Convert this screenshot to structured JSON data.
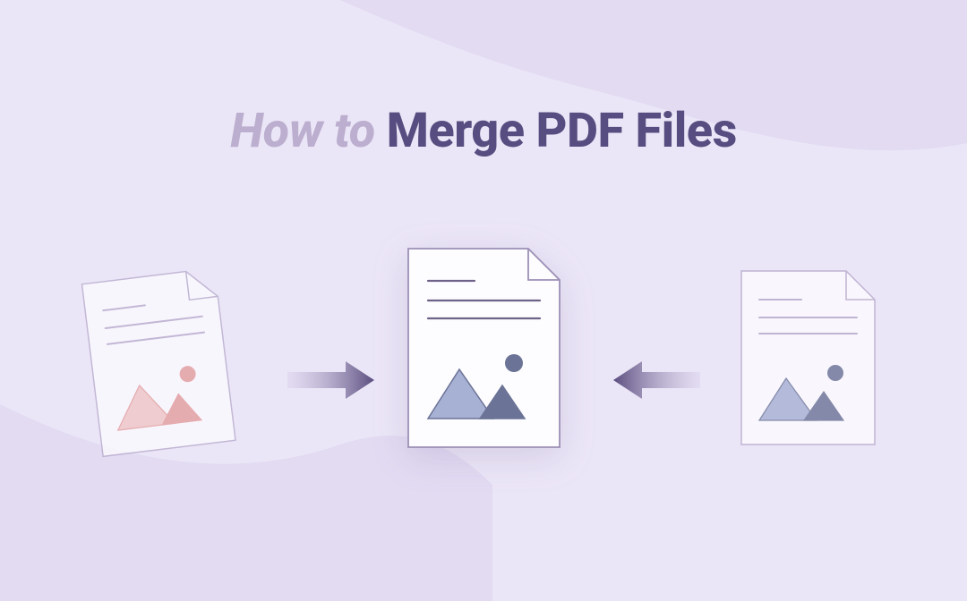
{
  "title": {
    "light": "How to ",
    "dark": "Merge PDF Files"
  },
  "colors": {
    "bg": "#ebe6f7",
    "wave": "#e2dbf2",
    "title_light": "#bcaecf",
    "title_dark": "#584d80",
    "doc_fill": "#fdfcff",
    "doc_stroke": "#b5a8ca",
    "line": "#8a7ea6",
    "red_light": "#f0c4c2",
    "red_dark": "#e49999",
    "blue_light": "#a7b1d4",
    "blue_dark": "#6b7396",
    "arrow_light": "#cfc4e3",
    "arrow_dark": "#5a4d7e"
  }
}
